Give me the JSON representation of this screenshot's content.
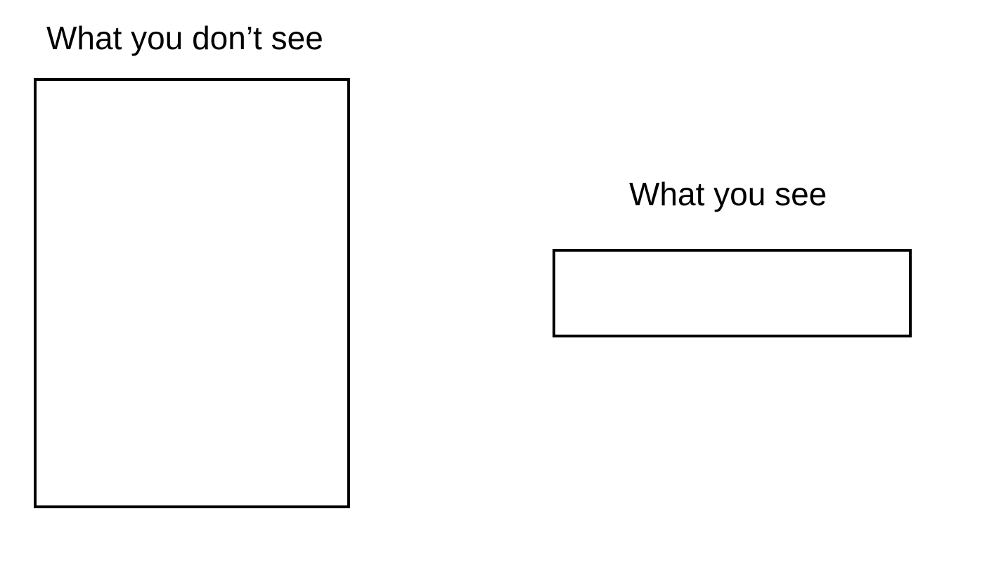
{
  "panels": [
    {
      "label": "What you don’t see"
    },
    {
      "label": "What you see"
    }
  ]
}
